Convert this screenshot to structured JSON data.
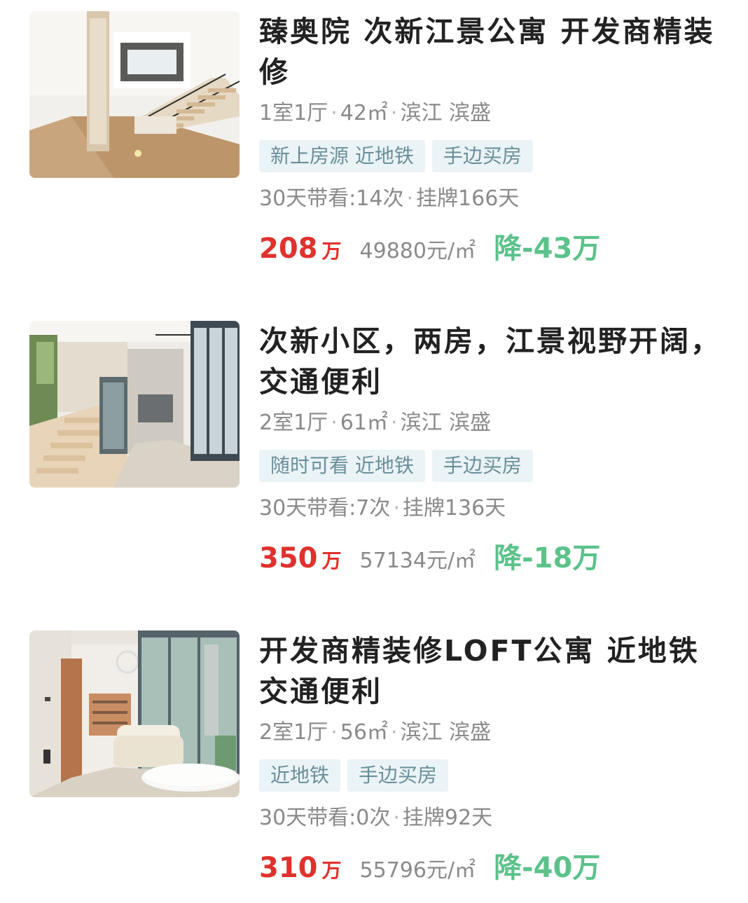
{
  "listings": [
    {
      "title": "臻奥院 次新江景公寓 开发商精装修",
      "image": "interior-staircase-photo",
      "layout": "1室1厅",
      "area": "42㎡",
      "location": "滨江 滨盛",
      "tags": [
        "新上房源 近地铁",
        "手边买房"
      ],
      "viewings": "30天带看:14次",
      "listed": "挂牌166天",
      "price": "208",
      "price_unit": "万",
      "unit_price": "49880元/㎡",
      "price_drop": "降-43万"
    },
    {
      "title": "次新小区，两房，江景视野开阔，交通便利",
      "image": "loft-living-photo",
      "layout": "2室1厅",
      "area": "61㎡",
      "location": "滨江 滨盛",
      "tags": [
        "随时可看 近地铁",
        "手边买房"
      ],
      "viewings": "30天带看:7次",
      "listed": "挂牌136天",
      "price": "350",
      "price_unit": "万",
      "unit_price": "57134元/㎡",
      "price_drop": "降-18万"
    },
    {
      "title": "开发商精装修LOFT公寓 近地铁交通便利",
      "image": "sofa-living-room-photo",
      "layout": "2室1厅",
      "area": "56㎡",
      "location": "滨江 滨盛",
      "tags": [
        "近地铁",
        "手边买房"
      ],
      "viewings": "30天带看:0次",
      "listed": "挂牌92天",
      "price": "310",
      "price_unit": "万",
      "unit_price": "55796元/㎡",
      "price_drop": "降-40万"
    }
  ],
  "separator": "·",
  "colors": {
    "price": "#e0312d",
    "drop": "#5cc28a",
    "tag_bg": "#eaf3f6",
    "tag_text": "#6a8f99"
  }
}
